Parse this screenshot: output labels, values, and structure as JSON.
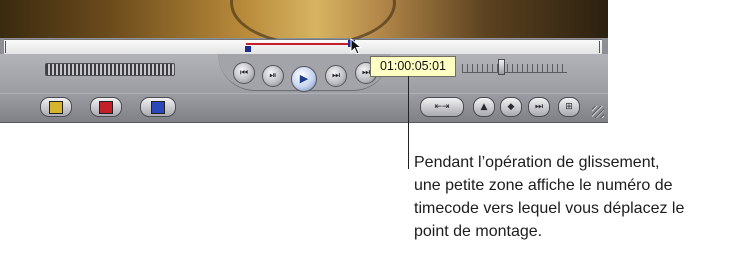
{
  "viewer": {
    "timecode_tooltip": "01:00:05:01",
    "transport_icons": {
      "prev_edit": "⏮",
      "play_in_to_out": "⏯",
      "play": "▶",
      "play_around": "⏭",
      "next_edit": "⏭"
    },
    "mark_buttons": {
      "mark_in_icon": "yellow-mark-in-icon",
      "mark_out_icon": "red-mark-out-icon",
      "overwrite_icon": "blue-clip-icon"
    },
    "right_buttons": {
      "match_frame": "⇤⇥",
      "add_marker": "▲",
      "add_keyframe": "◆",
      "mark_clip": "⏭",
      "show_match": "⊞"
    },
    "colors": {
      "marked_range": "#c4202a",
      "markers": "#1d2b8a",
      "tooltip_bg": "#ffffc4"
    }
  },
  "caption": {
    "lines": [
      "Pendant l’opération de glissement,",
      "une petite zone affiche le numéro de",
      "timecode vers lequel vous déplacez le",
      "point de montage."
    ]
  }
}
